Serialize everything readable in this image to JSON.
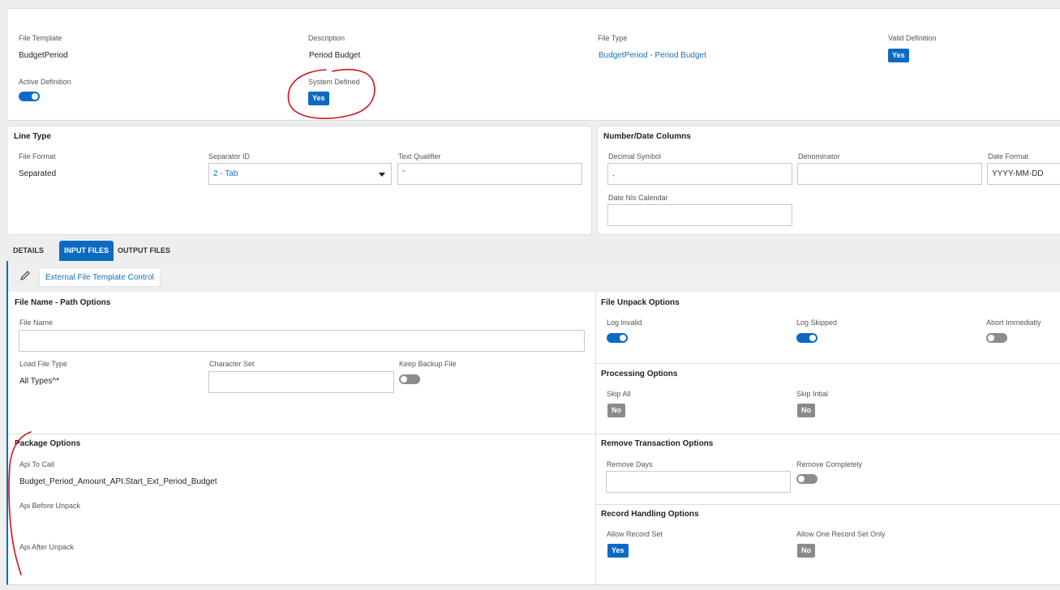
{
  "header": {
    "file_template": {
      "label": "File Template",
      "value": "BudgetPeriod"
    },
    "description": {
      "label": "Description",
      "value": "Period Budget"
    },
    "file_type": {
      "label": "File Type",
      "value": "BudgetPeriod - Period Budget"
    },
    "valid_definition": {
      "label": "Valid Definition",
      "value": "Yes"
    },
    "active_definition": {
      "label": "Active Definition",
      "state": "on"
    },
    "system_defined": {
      "label": "System Defined",
      "value": "Yes"
    }
  },
  "line_type": {
    "title": "Line Type",
    "file_format": {
      "label": "File Format",
      "value": "Separated"
    },
    "separator_id": {
      "label": "Separator ID",
      "value": "2 - Tab"
    },
    "text_qualifier": {
      "label": "Text Qualifier",
      "value": "\""
    }
  },
  "number_date": {
    "title": "Number/Date Columns",
    "decimal_symbol": {
      "label": "Decimal Symbol",
      "value": "."
    },
    "denominator": {
      "label": "Denominator",
      "value": ""
    },
    "date_format": {
      "label": "Date Format",
      "value": "YYYY-MM-DD"
    },
    "date_nls_calendar": {
      "label": "Date Nls Calendar",
      "value": ""
    }
  },
  "tabs": [
    {
      "label": "DETAILS",
      "active": false
    },
    {
      "label": "INPUT FILES",
      "active": true
    },
    {
      "label": "OUTPUT FILES",
      "active": false
    }
  ],
  "toolbar": {
    "external_button": "External File Template Control"
  },
  "file_name_path": {
    "title": "File Name - Path Options",
    "file_name": {
      "label": "File Name",
      "value": ""
    },
    "load_file_type": {
      "label": "Load File Type",
      "value": "All Types^*"
    },
    "character_set": {
      "label": "Character Set",
      "value": ""
    },
    "keep_backup_file": {
      "label": "Keep Backup File",
      "state": "off"
    }
  },
  "file_unpack": {
    "title": "File Unpack Options",
    "log_invalid": {
      "label": "Log Invalid",
      "state": "on"
    },
    "log_skipped": {
      "label": "Log Skipped",
      "state": "on"
    },
    "abort_immediatly": {
      "label": "Abort Immediatly",
      "state": "off"
    }
  },
  "processing": {
    "title": "Processing Options",
    "skip_all": {
      "label": "Skip All",
      "value": "No"
    },
    "skip_intial": {
      "label": "Skip Intial",
      "value": "No"
    }
  },
  "package": {
    "title": "Package Options",
    "api_to_call": {
      "label": "Api To Call",
      "value": "Budget_Period_Amount_API.Start_Ext_Period_Budget"
    },
    "api_before_unpack": {
      "label": "Api Before Unpack",
      "value": ""
    },
    "api_after_unpack": {
      "label": "Api After Unpack",
      "value": ""
    }
  },
  "remove_transaction": {
    "title": "Remove Transaction Options",
    "remove_days": {
      "label": "Remove Days",
      "value": ""
    },
    "remove_completely": {
      "label": "Remove Completely",
      "state": "off"
    }
  },
  "record_handling": {
    "title": "Record Handling Options",
    "allow_record_set": {
      "label": "Allow Record Set",
      "value": "Yes"
    },
    "allow_one_record_set_only": {
      "label": "Allow One Record Set Only",
      "value": "No"
    }
  },
  "annotation_color": "#d0141e",
  "accent_color": "#0b6bc2"
}
